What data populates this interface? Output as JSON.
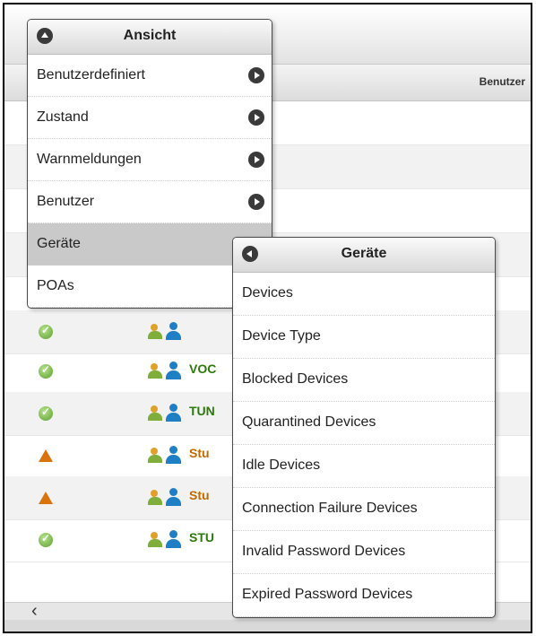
{
  "grid": {
    "column_header": "Benutzer",
    "rows": [
      {
        "status": "ok",
        "user": ""
      },
      {
        "status": "ok",
        "user": "VOC"
      },
      {
        "status": "ok",
        "user": "TUN"
      },
      {
        "status": "warn",
        "user": "Stu"
      },
      {
        "status": "warn",
        "user": "Stu"
      },
      {
        "status": "ok",
        "user": "STU"
      }
    ]
  },
  "menu_ansicht": {
    "title": "Ansicht",
    "items": [
      {
        "label": "Benutzerdefiniert"
      },
      {
        "label": "Zustand"
      },
      {
        "label": "Warnmeldungen"
      },
      {
        "label": "Benutzer"
      },
      {
        "label": "Geräte"
      },
      {
        "label": "POAs"
      }
    ]
  },
  "menu_geraete": {
    "title": "Geräte",
    "items": [
      {
        "label": "Devices"
      },
      {
        "label": "Device Type"
      },
      {
        "label": "Blocked Devices"
      },
      {
        "label": "Quarantined Devices"
      },
      {
        "label": "Idle Devices"
      },
      {
        "label": "Connection Failure Devices"
      },
      {
        "label": "Invalid Password Devices"
      },
      {
        "label": "Expired Password Devices"
      }
    ]
  },
  "scrollbar": {
    "left_arrow": "‹"
  }
}
